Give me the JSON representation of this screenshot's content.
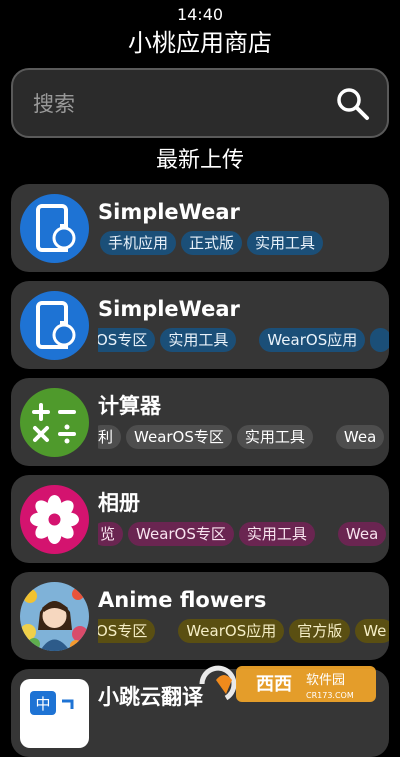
{
  "status": {
    "time": "14:40"
  },
  "app": {
    "title": "小桃应用商店"
  },
  "search": {
    "placeholder": "搜索"
  },
  "section": {
    "title": "最新上传"
  },
  "cards": [
    {
      "name": "SimpleWear",
      "tag_bg": "#1b4f78",
      "tag_fg": "#e9f2fa",
      "icon": "phone-watch-icon",
      "tags": [
        "手机应用",
        "正式版",
        "实用工具"
      ]
    },
    {
      "name": "SimpleWear",
      "tag_bg": "#1b4f78",
      "tag_fg": "#e9f2fa",
      "icon": "phone-watch-icon",
      "tags": [
        "OS专区",
        "实用工具",
        "WearOS应用"
      ]
    },
    {
      "name": "计算器",
      "tag_bg": "#4e4e4e",
      "tag_fg": "#ffffff",
      "icon": "calculator-icon",
      "tags": [
        "利",
        "WearOS专区",
        "实用工具",
        "Wea"
      ]
    },
    {
      "name": "相册",
      "tag_bg": "#6a2551",
      "tag_fg": "#f8e4ef",
      "icon": "flower-icon",
      "tags": [
        "览",
        "WearOS专区",
        "实用工具",
        "Wea"
      ]
    },
    {
      "name": "Anime flowers",
      "tag_bg": "#5a4f12",
      "tag_fg": "#f5eec6",
      "icon": "anime-avatar-icon",
      "tags": [
        "OS专区",
        "WearOS应用",
        "官方版",
        "We"
      ]
    },
    {
      "name": "小跳云翻译",
      "icon": "translate-icon",
      "tags": []
    }
  ],
  "watermark": {
    "text": "西西软件园",
    "sub": "CR173.COM"
  }
}
